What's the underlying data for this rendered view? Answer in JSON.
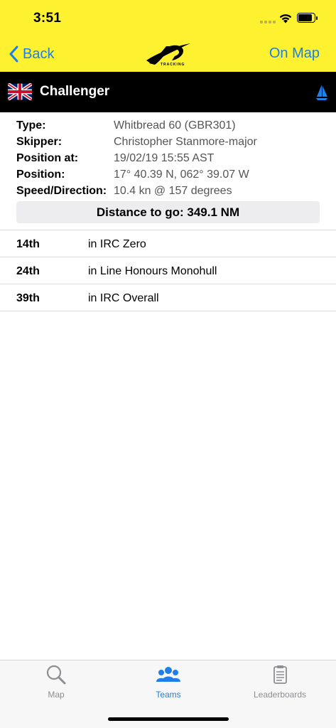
{
  "status_bar": {
    "time": "3:51"
  },
  "nav": {
    "back_label": "Back",
    "logo_sub": "TRACKING",
    "on_map_label": "On Map"
  },
  "boat": {
    "flag": "uk-flag",
    "name": "Challenger",
    "icon": "sailboat-icon"
  },
  "details": [
    {
      "label": "Type:",
      "value": "Whitbread 60 (GBR301)"
    },
    {
      "label": "Skipper:",
      "value": "Christopher Stanmore-major"
    },
    {
      "label": "Position at:",
      "value": "19/02/19 15:55 AST"
    },
    {
      "label": "Position:",
      "value": "17° 40.39 N, 062° 39.07 W"
    },
    {
      "label": "Speed/Direction:",
      "value": "10.4 kn @ 157 degrees"
    }
  ],
  "distance_to_go": "Distance to go: 349.1 NM",
  "rankings": [
    {
      "position": "14th",
      "text": "in IRC Zero"
    },
    {
      "position": "24th",
      "text": "in Line Honours Monohull"
    },
    {
      "position": "39th",
      "text": "in IRC Overall"
    }
  ],
  "tabs": [
    {
      "label": "Map",
      "icon": "search-icon",
      "active": false
    },
    {
      "label": "Teams",
      "icon": "teams-icon",
      "active": true
    },
    {
      "label": "Leaderboards",
      "icon": "leaderboard-icon",
      "active": false
    }
  ],
  "colors": {
    "header_yellow": "#fef230",
    "accent_blue": "#1d7fe7",
    "boat_bar": "#000000"
  }
}
